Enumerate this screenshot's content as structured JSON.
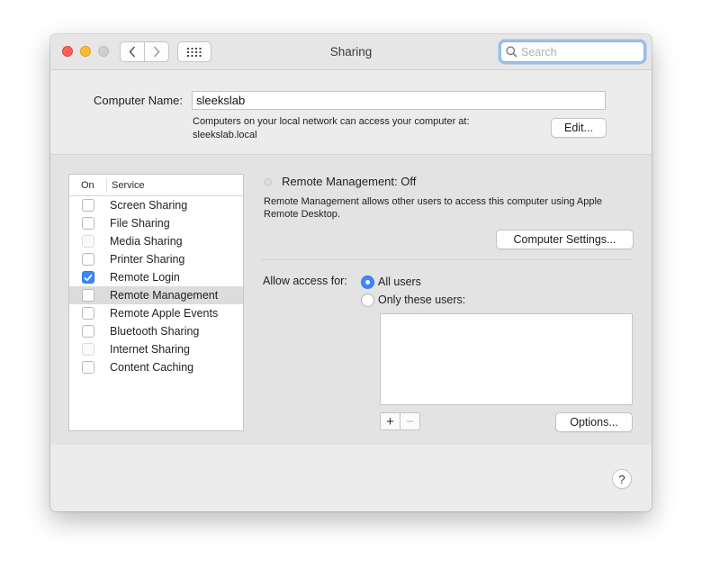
{
  "window": {
    "title": "Sharing"
  },
  "toolbar": {
    "back_icon": "chevron-left-icon",
    "forward_icon": "chevron-right-icon",
    "grid_icon": "grid-icon",
    "search_placeholder": "Search",
    "search_value": ""
  },
  "computer_name": {
    "label": "Computer Name:",
    "value": "sleekslab",
    "description_line1": "Computers on your local network can access your computer at:",
    "description_line2": "sleekslab.local",
    "edit_label": "Edit..."
  },
  "services": {
    "header_on": "On",
    "header_service": "Service",
    "items": [
      {
        "label": "Screen Sharing",
        "checked": false,
        "enabled": true
      },
      {
        "label": "File Sharing",
        "checked": false,
        "enabled": true
      },
      {
        "label": "Media Sharing",
        "checked": false,
        "enabled": false
      },
      {
        "label": "Printer Sharing",
        "checked": false,
        "enabled": true
      },
      {
        "label": "Remote Login",
        "checked": true,
        "enabled": true
      },
      {
        "label": "Remote Management",
        "checked": false,
        "enabled": true,
        "selected": true
      },
      {
        "label": "Remote Apple Events",
        "checked": false,
        "enabled": true
      },
      {
        "label": "Bluetooth Sharing",
        "checked": false,
        "enabled": true
      },
      {
        "label": "Internet Sharing",
        "checked": false,
        "enabled": false
      },
      {
        "label": "Content Caching",
        "checked": false,
        "enabled": true
      }
    ]
  },
  "detail": {
    "status": "Remote Management: Off",
    "description_line1": "Remote Management allows other users to access this computer using Apple",
    "description_line2": "Remote Desktop.",
    "computer_settings_label": "Computer Settings...",
    "allow_access_label": "Allow access for:",
    "option_all_users": "All users",
    "option_only_these": "Only these users:",
    "selected_option": "All users",
    "add_label": "+",
    "remove_label": "−",
    "options_label": "Options..."
  },
  "help_label": "?",
  "colors": {
    "accent": "#3d88f6",
    "close": "#fe5f57",
    "minimize": "#febc2e"
  }
}
